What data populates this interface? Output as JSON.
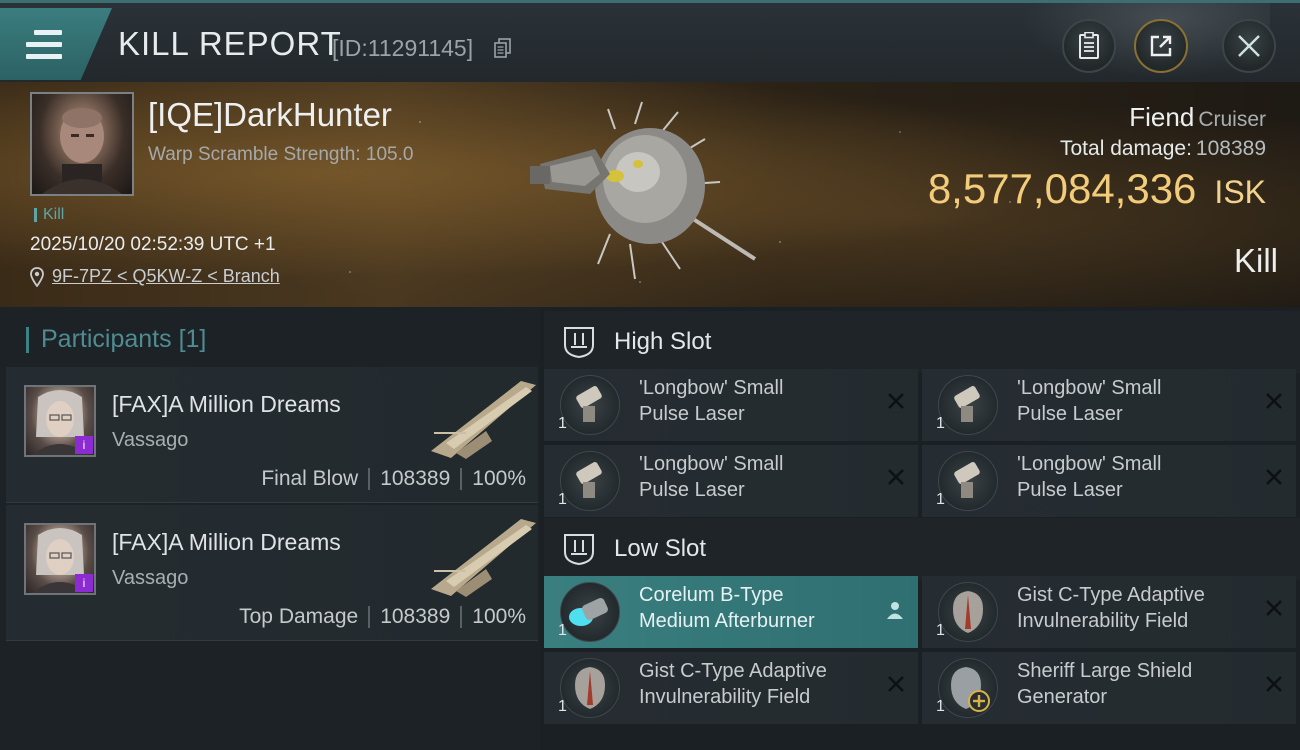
{
  "header": {
    "title": "KILL REPORT",
    "report_id": "[ID:11291145]"
  },
  "victim": {
    "name": "[IQE]DarkHunter",
    "warp_scramble": "Warp Scramble Strength: 105.0",
    "tag": "Kill",
    "datetime": "2025/10/20 02:52:39 UTC +1",
    "location": "9F-7PZ < Q5KW-Z < Branch",
    "ship": "Fiend",
    "ship_class": "Cruiser",
    "total_damage_label": "Total damage:",
    "total_damage": "108389",
    "isk_value": "8,577,084,336",
    "isk_unit": "ISK",
    "result": "Kill"
  },
  "participants": {
    "title": "Participants",
    "count": "[1]",
    "items": [
      {
        "name": "[FAX]A Million Dreams",
        "ship": "Vassago",
        "role": "Final Blow",
        "damage": "108389",
        "percent": "100%"
      },
      {
        "name": "[FAX]A Million Dreams",
        "ship": "Vassago",
        "role": "Top Damage",
        "damage": "108389",
        "percent": "100%"
      }
    ]
  },
  "high_slot": {
    "title": "High Slot",
    "modules": [
      {
        "name_line1": "'Longbow' Small",
        "name_line2": "Pulse Laser",
        "qty": "1",
        "icon": "laser-icon"
      },
      {
        "name_line1": "'Longbow' Small",
        "name_line2": "Pulse Laser",
        "qty": "1",
        "icon": "laser-icon"
      },
      {
        "name_line1": "'Longbow' Small",
        "name_line2": "Pulse Laser",
        "qty": "1",
        "icon": "laser-icon"
      },
      {
        "name_line1": "'Longbow' Small",
        "name_line2": "Pulse Laser",
        "qty": "1",
        "icon": "laser-icon"
      }
    ]
  },
  "low_slot": {
    "title": "Low Slot",
    "modules": [
      {
        "name_line1": "Corelum B-Type",
        "name_line2": "Medium Afterburner",
        "qty": "1",
        "icon": "afterburner-icon"
      },
      {
        "name_line1": "Gist C-Type Adaptive",
        "name_line2": "Invulnerability Field",
        "qty": "1",
        "icon": "shield-field-icon"
      },
      {
        "name_line1": "Gist C-Type Adaptive",
        "name_line2": "Invulnerability Field",
        "qty": "1",
        "icon": "shield-field-icon"
      },
      {
        "name_line1": "Sheriff Large Shield",
        "name_line2": "Generator",
        "qty": "1",
        "icon": "shield-generator-icon"
      }
    ]
  },
  "colors": {
    "accent_teal": "#3b7d7f",
    "isk_gold": "#f2cc7a",
    "badge_purple": "#8c2bd1"
  }
}
